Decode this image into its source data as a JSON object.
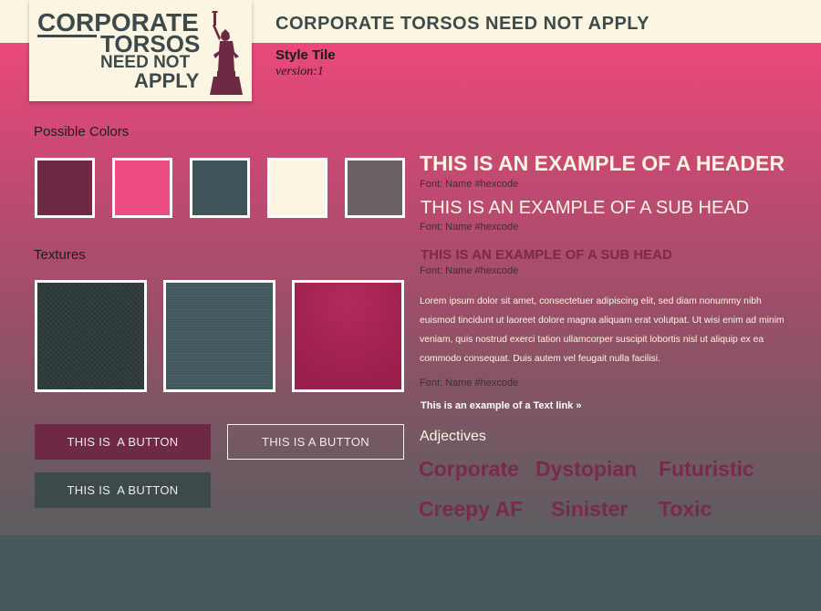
{
  "logo": {
    "lines": [
      "CORPORATE",
      "TORSOS",
      "NEED NOT",
      "APPLY"
    ]
  },
  "header": {
    "title": "CORPORATE TORSOS NEED NOT APPLY",
    "tile_title": "Style Tile",
    "version": "version:1"
  },
  "colors": {
    "label": "Possible Colors",
    "swatches": [
      "#6e2a45",
      "#ec4c80",
      "#40555a",
      "#fcf5e2",
      "#6b6266"
    ]
  },
  "textures": {
    "label": "Textures",
    "items": [
      "#2e3a3b",
      "#41575c",
      "#a42152"
    ]
  },
  "buttons": {
    "primary": "THIS IS  A BUTTON",
    "outline": "THIS IS A BUTTON",
    "dark": "THIS IS  A BUTTON"
  },
  "typography": {
    "header": "THIS IS AN EXAMPLE OF A HEADER",
    "subhead1": "THIS IS AN EXAMPLE OF A SUB HEAD",
    "subhead2": "THIS IS AN EXAMPLE OF A SUB HEAD",
    "font_note": "Font: Name #hexcode",
    "paragraph": "Lorem ipsum dolor sit amet, consectetuer adipiscing elit, sed diam nonummy nibh euismod tincidunt ut laoreet dolore magna aliquam erat volutpat. Ut wisi enim ad minim veniam, quis nostrud exerci tation ullamcorper suscipit lobortis nisl ut aliquip ex ea commodo consequat. Duis autem vel feugait nulla facilisi.",
    "text_link": "This is an example of a Text link »"
  },
  "adjectives": {
    "label": "Adjectives",
    "words": [
      "Corporate",
      "Dystopian",
      "Futuristic",
      "Creepy AF",
      "Sinister",
      "Toxic"
    ]
  }
}
